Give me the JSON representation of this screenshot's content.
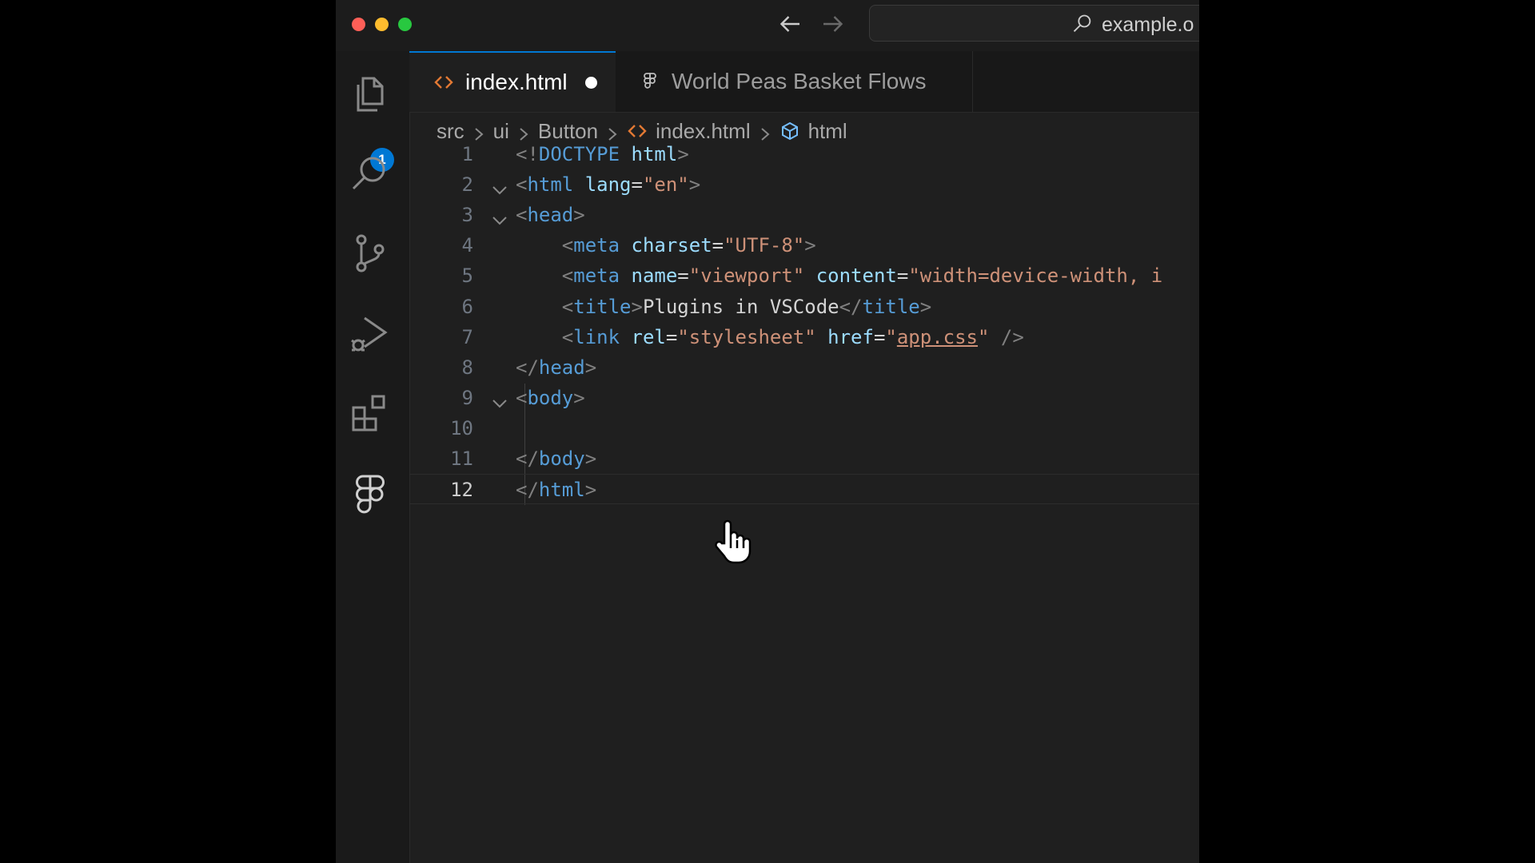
{
  "titlebar": {
    "search_text": "example.o"
  },
  "activity_bar": {
    "explorer_badge": "1",
    "items": [
      "explorer-icon",
      "search-icon",
      "source-control-icon",
      "run-debug-icon",
      "extensions-icon",
      "figma-icon"
    ]
  },
  "tabs": [
    {
      "label": "index.html",
      "icon": "html-icon",
      "dirty": true,
      "active": true
    },
    {
      "label": "World Peas Basket Flows",
      "icon": "figma-icon",
      "active": false
    }
  ],
  "breadcrumb": {
    "items": [
      "src",
      "ui",
      "Button",
      "index.html",
      "html"
    ]
  },
  "editor": {
    "current_line": 12,
    "lines": [
      {
        "num": "1",
        "parts": [
          [
            "br",
            "<!"
          ],
          [
            "tag",
            "DOCTYPE"
          ],
          [
            "txt",
            " "
          ],
          [
            "attr",
            "html"
          ],
          [
            "br",
            ">"
          ]
        ]
      },
      {
        "num": "2",
        "parts": [
          [
            "br",
            "<"
          ],
          [
            "tag",
            "html"
          ],
          [
            "txt",
            " "
          ],
          [
            "attr",
            "lang"
          ],
          [
            "txt",
            "="
          ],
          [
            "str",
            "\"en\""
          ],
          [
            "br",
            ">"
          ]
        ]
      },
      {
        "num": "3",
        "parts": [
          [
            "br",
            "<"
          ],
          [
            "tag",
            "head"
          ],
          [
            "br",
            ">"
          ]
        ]
      },
      {
        "num": "4",
        "parts": [
          [
            "txt",
            "    "
          ],
          [
            "br",
            "<"
          ],
          [
            "tag",
            "meta"
          ],
          [
            "txt",
            " "
          ],
          [
            "attr",
            "charset"
          ],
          [
            "txt",
            "="
          ],
          [
            "str",
            "\"UTF-8\""
          ],
          [
            "br",
            ">"
          ]
        ]
      },
      {
        "num": "5",
        "parts": [
          [
            "txt",
            "    "
          ],
          [
            "br",
            "<"
          ],
          [
            "tag",
            "meta"
          ],
          [
            "txt",
            " "
          ],
          [
            "attr",
            "name"
          ],
          [
            "txt",
            "="
          ],
          [
            "str",
            "\"viewport\""
          ],
          [
            "txt",
            " "
          ],
          [
            "attr",
            "content"
          ],
          [
            "txt",
            "="
          ],
          [
            "str",
            "\"width=device-width, i"
          ]
        ]
      },
      {
        "num": "6",
        "parts": [
          [
            "txt",
            "    "
          ],
          [
            "br",
            "<"
          ],
          [
            "tag",
            "title"
          ],
          [
            "br",
            ">"
          ],
          [
            "txt",
            "Plugins in VSCode"
          ],
          [
            "br",
            "</"
          ],
          [
            "tag",
            "title"
          ],
          [
            "br",
            ">"
          ]
        ]
      },
      {
        "num": "7",
        "parts": [
          [
            "txt",
            "    "
          ],
          [
            "br",
            "<"
          ],
          [
            "tag",
            "link"
          ],
          [
            "txt",
            " "
          ],
          [
            "attr",
            "rel"
          ],
          [
            "txt",
            "="
          ],
          [
            "str",
            "\"stylesheet\""
          ],
          [
            "txt",
            " "
          ],
          [
            "attr",
            "href"
          ],
          [
            "txt",
            "="
          ],
          [
            "str",
            "\""
          ],
          [
            "link",
            "app.css"
          ],
          [
            "str",
            "\""
          ],
          [
            "txt",
            " "
          ],
          [
            "br",
            "/>"
          ]
        ]
      },
      {
        "num": "8",
        "parts": [
          [
            "br",
            "</"
          ],
          [
            "tag",
            "head"
          ],
          [
            "br",
            ">"
          ]
        ]
      },
      {
        "num": "9",
        "parts": [
          [
            "br",
            "<"
          ],
          [
            "tag",
            "body"
          ],
          [
            "br",
            ">"
          ]
        ]
      },
      {
        "num": "10",
        "parts": []
      },
      {
        "num": "11",
        "parts": [
          [
            "br",
            "</"
          ],
          [
            "tag",
            "body"
          ],
          [
            "br",
            ">"
          ]
        ]
      },
      {
        "num": "12",
        "parts": [
          [
            "br",
            "</"
          ],
          [
            "tag",
            "html"
          ],
          [
            "br",
            ">"
          ]
        ]
      }
    ],
    "folded_lines": [
      "2",
      "3",
      "9"
    ]
  },
  "colors": {
    "tag": "#569cd6",
    "attr": "#9cdcfe",
    "string": "#ce9178",
    "bracket": "#808080",
    "accent": "#0078d4"
  }
}
